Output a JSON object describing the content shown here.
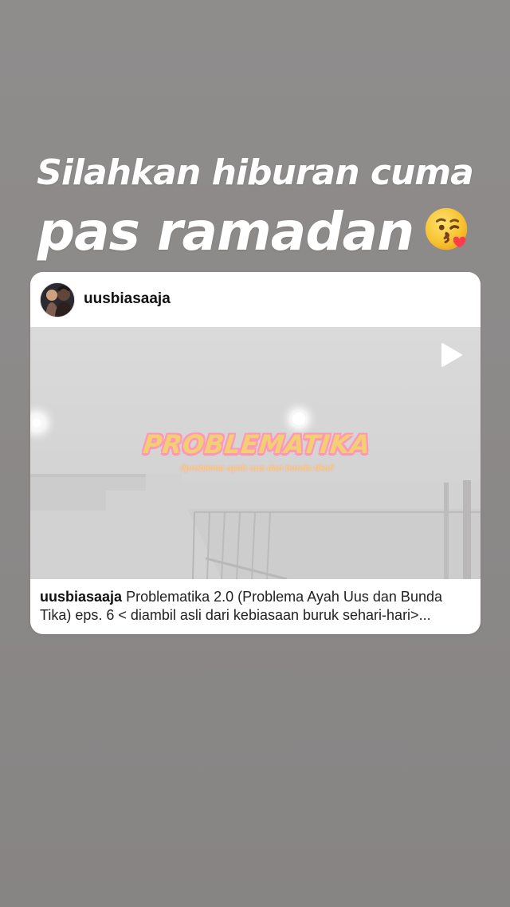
{
  "story": {
    "headline_line1": "Silahkan hiburan cuma",
    "headline_line2": "pas ramadan",
    "emoji_name": "kissing-face-icon"
  },
  "post_card": {
    "username": "uusbiasaaja",
    "video": {
      "play_icon": "play-icon",
      "overlay_title": "PROBLEMATIKA",
      "overlay_subtitle": "//problema ayah uus dan bunda tika//"
    },
    "caption": {
      "username": "uusbiasaaja",
      "text": "Problematika 2.0 (Problema Ayah Uus dan Bunda Tika) eps. 6 < diambil asli dari kebiasaan buruk sehari-hari>..."
    }
  },
  "colors": {
    "background": "#8c8989",
    "card_background": "#ffffff",
    "headline_text": "#ffffff",
    "overlay_yellow": "#f3cf73",
    "overlay_pink": "#ff97b8"
  }
}
